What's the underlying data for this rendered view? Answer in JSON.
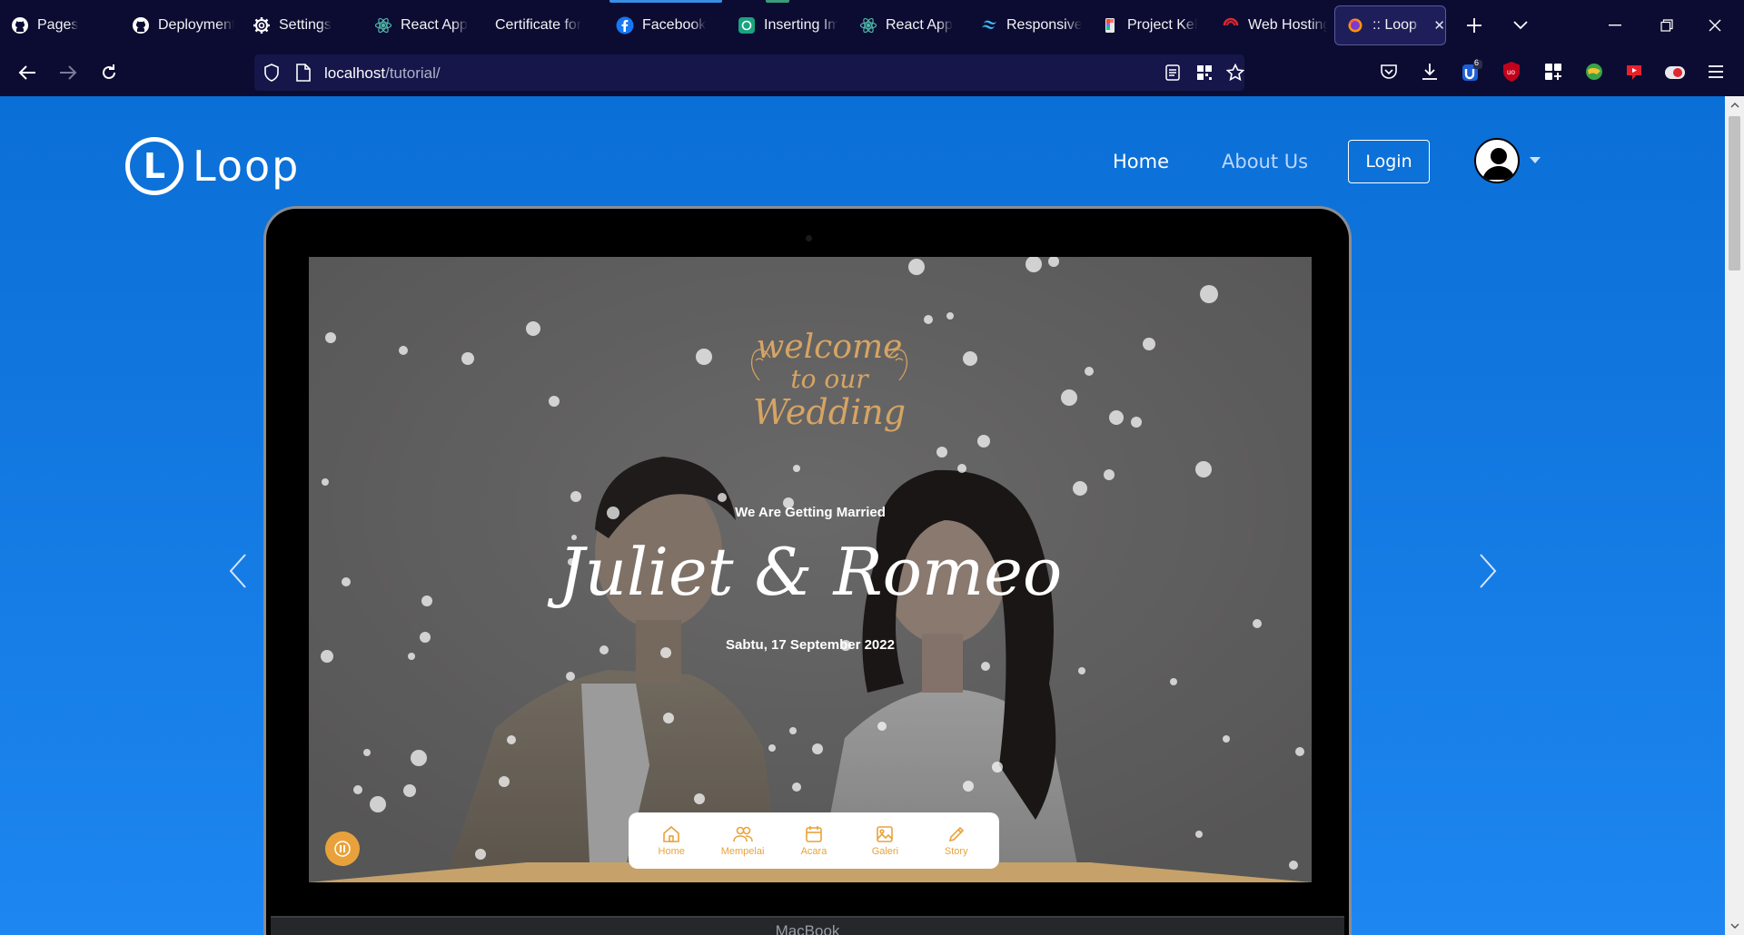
{
  "browser": {
    "tabs": [
      {
        "label": "Pages",
        "icon": "github-icon"
      },
      {
        "label": "Deployments",
        "icon": "github-icon"
      },
      {
        "label": "Settings",
        "icon": "gear-icon"
      },
      {
        "label": "React App",
        "icon": "react-icon"
      },
      {
        "label": "Certificate for",
        "icon": "none"
      },
      {
        "label": "Facebook",
        "icon": "facebook-icon"
      },
      {
        "label": "Inserting Im",
        "icon": "openai-icon"
      },
      {
        "label": "React App",
        "icon": "react-icon"
      },
      {
        "label": "Responsive",
        "icon": "tailwind-icon"
      },
      {
        "label": "Project Kel",
        "icon": "figma-icon"
      },
      {
        "label": "Web Hosting",
        "icon": "hosting-icon"
      },
      {
        "label": ":: Loop ::",
        "icon": "firefox-icon",
        "active": true
      }
    ],
    "url_host": "localhost",
    "url_path": "/tutorial/",
    "extension_badge": "6",
    "colors": {
      "chrome": "#0c0c32",
      "urlbar": "#16164a",
      "facebook_indicator": "#3a8ee6",
      "openai_indicator": "#3a9c7a"
    }
  },
  "site": {
    "logo_letter": "L",
    "logo_text": "Loop",
    "nav": {
      "home": "Home",
      "about": "About Us",
      "login": "Login"
    },
    "colors": {
      "background_top": "#0a6fd6",
      "background_bottom": "#1e86f0",
      "about_link": "#bcd6ff"
    }
  },
  "wedding": {
    "welcome_line1": "welcome",
    "welcome_line2": "to our",
    "welcome_line3": "Wedding",
    "tagline": "We Are Getting Married",
    "couple": "Juliet & Romeo",
    "date": "Sabtu, 17 September 2022",
    "bottom_nav": [
      {
        "label": "Home",
        "icon": "home-icon"
      },
      {
        "label": "Mempelai",
        "icon": "couple-icon"
      },
      {
        "label": "Acara",
        "icon": "calendar-icon"
      },
      {
        "label": "Galeri",
        "icon": "gallery-icon"
      },
      {
        "label": "Story",
        "icon": "pencil-icon"
      }
    ],
    "accent": "#e9a23b"
  },
  "laptop": {
    "brand": "MacBook"
  }
}
